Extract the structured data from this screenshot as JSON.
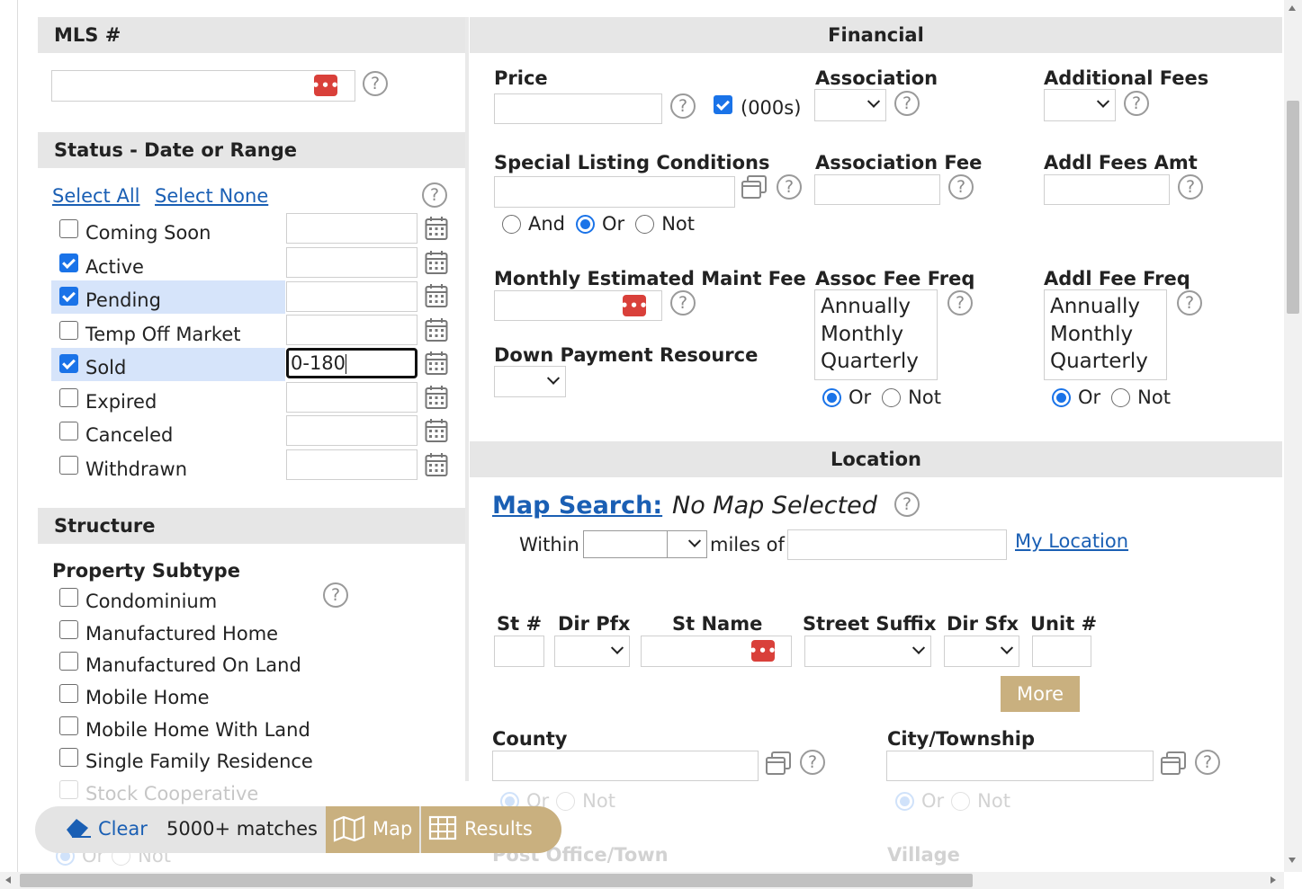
{
  "mls": {
    "title": "MLS #",
    "value": ""
  },
  "status": {
    "title": "Status - Date or Range",
    "select_all": "Select All",
    "select_none": "Select None",
    "items": [
      {
        "label": "Coming Soon",
        "checked": false,
        "value": ""
      },
      {
        "label": "Active",
        "checked": true,
        "value": ""
      },
      {
        "label": "Pending",
        "checked": true,
        "value": ""
      },
      {
        "label": "Temp Off Market",
        "checked": false,
        "value": ""
      },
      {
        "label": "Sold",
        "checked": true,
        "value": "0-180"
      },
      {
        "label": "Expired",
        "checked": false,
        "value": ""
      },
      {
        "label": "Canceled",
        "checked": false,
        "value": ""
      },
      {
        "label": "Withdrawn",
        "checked": false,
        "value": ""
      }
    ]
  },
  "structure": {
    "title": "Structure",
    "subtype_label": "Property Subtype",
    "items": [
      "Condominium",
      "Manufactured Home",
      "Manufactured On Land",
      "Mobile Home",
      "Mobile Home With Land",
      "Single Family Residence",
      "Stock Cooperative"
    ],
    "or_label": "Or",
    "not_label": "Not"
  },
  "financial": {
    "title": "Financial",
    "price_label": "Price",
    "thousands_label": "(000s)",
    "association_label": "Association",
    "additional_fees_label": "Additional Fees",
    "special_listing_label": "Special Listing Conditions",
    "association_fee_label": "Association Fee",
    "addl_fees_amt_label": "Addl Fees Amt",
    "and_label": "And",
    "or_label": "Or",
    "not_label": "Not",
    "monthly_maint_label": "Monthly Estimated Maint Fee",
    "assoc_fee_freq_label": "Assoc Fee Freq",
    "addl_fee_freq_label": "Addl Fee Freq",
    "freq_options": [
      "Annually",
      "Monthly",
      "Quarterly"
    ],
    "down_payment_label": "Down Payment Resource"
  },
  "location": {
    "title": "Location",
    "map_search_label": "Map Search:",
    "map_status": "No Map Selected",
    "within_label": "Within",
    "miles_of_label": "miles of",
    "my_location_label": "My Location",
    "st_num_label": "St #",
    "dir_pfx_label": "Dir Pfx",
    "st_name_label": "St Name",
    "street_suffix_label": "Street Suffix",
    "dir_sfx_label": "Dir Sfx",
    "unit_label": "Unit #",
    "more_label": "More",
    "county_label": "County",
    "city_label": "City/Township",
    "or_label": "Or",
    "not_label": "Not",
    "post_office_label": "Post Office/Town",
    "village_label": "Village"
  },
  "toolbar": {
    "clear_label": "Clear",
    "matches": "5000+ matches",
    "map_label": "Map",
    "results_label": "Results"
  },
  "colors": {
    "accent": "#1a73e8",
    "header_bg": "#e6e6e6",
    "tan": "#c9b07f",
    "link": "#1a5fb4"
  }
}
